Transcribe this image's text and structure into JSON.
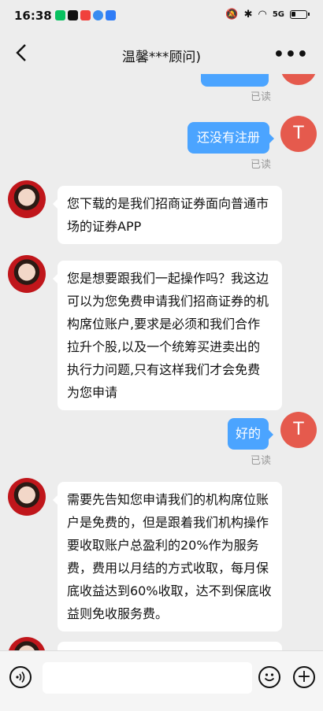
{
  "status_bar": {
    "time": "16:38",
    "network": "5G"
  },
  "nav": {
    "title": "温馨***顾问)"
  },
  "chat": {
    "messages": [
      {
        "sender": "me",
        "avatar_letter": "T",
        "text": "还没有注册",
        "status": "已读"
      },
      {
        "sender": "advisor",
        "text": "您下载的是我们招商证券面向普通市场的证券APP"
      },
      {
        "sender": "advisor",
        "text": "您是想要跟我们一起操作吗？我这边可以为您免费申请我们招商证券的机构席位账户,要求是必须和我们合作拉升个股,以及一个统筹买进卖出的执行力问题,只有这样我们才会免费为您申请"
      },
      {
        "sender": "me",
        "avatar_letter": "T",
        "text": "好的",
        "status": "已读"
      },
      {
        "sender": "advisor",
        "text": "需要先告知您申请我们的机构席位账户是免费的，但是跟着我们机构操作要收取账户总盈利的20%作为服务费，费用以月结的方式收取，每月保底收益达到60%收取，达不到保底收益则免收服务费。"
      }
    ],
    "partial_status": "已读",
    "partial_avatar_letter": "T"
  },
  "colors": {
    "bubble_blue": "#4ba4ff",
    "avatar_red": "#e55a4d",
    "background": "#ededed"
  }
}
